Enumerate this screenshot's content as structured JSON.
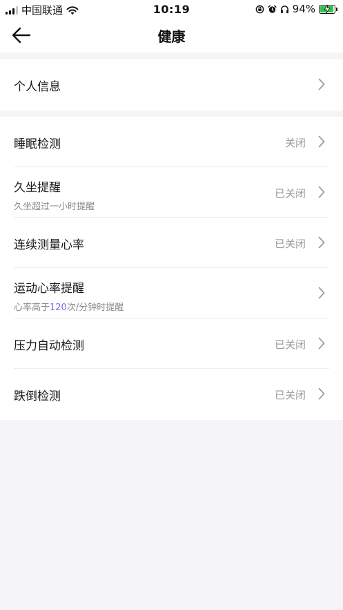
{
  "status_bar": {
    "carrier": "中国联通",
    "time": "10:19",
    "battery": "94%",
    "battery_level": 0.94
  },
  "nav": {
    "title": "健康"
  },
  "profile": {
    "label": "个人信息"
  },
  "settings": [
    {
      "title": "睡眠检测",
      "status": "关闭"
    },
    {
      "title": "久坐提醒",
      "status": "已关闭",
      "subtitle": "久坐超过一小时提醒"
    },
    {
      "title": "连续测量心率",
      "status": "已关闭"
    },
    {
      "title": "运动心率提醒",
      "status": "",
      "subtitle_prefix": "心率高于",
      "subtitle_value": "120",
      "subtitle_suffix": "次/分钟时提醒"
    },
    {
      "title": "压力自动检测",
      "status": "已关闭"
    },
    {
      "title": "跌倒检测",
      "status": "已关闭"
    }
  ],
  "colors": {
    "accent": "#7b6cf0",
    "battery_green": "#33c24d",
    "background": "#f5f5f7"
  }
}
